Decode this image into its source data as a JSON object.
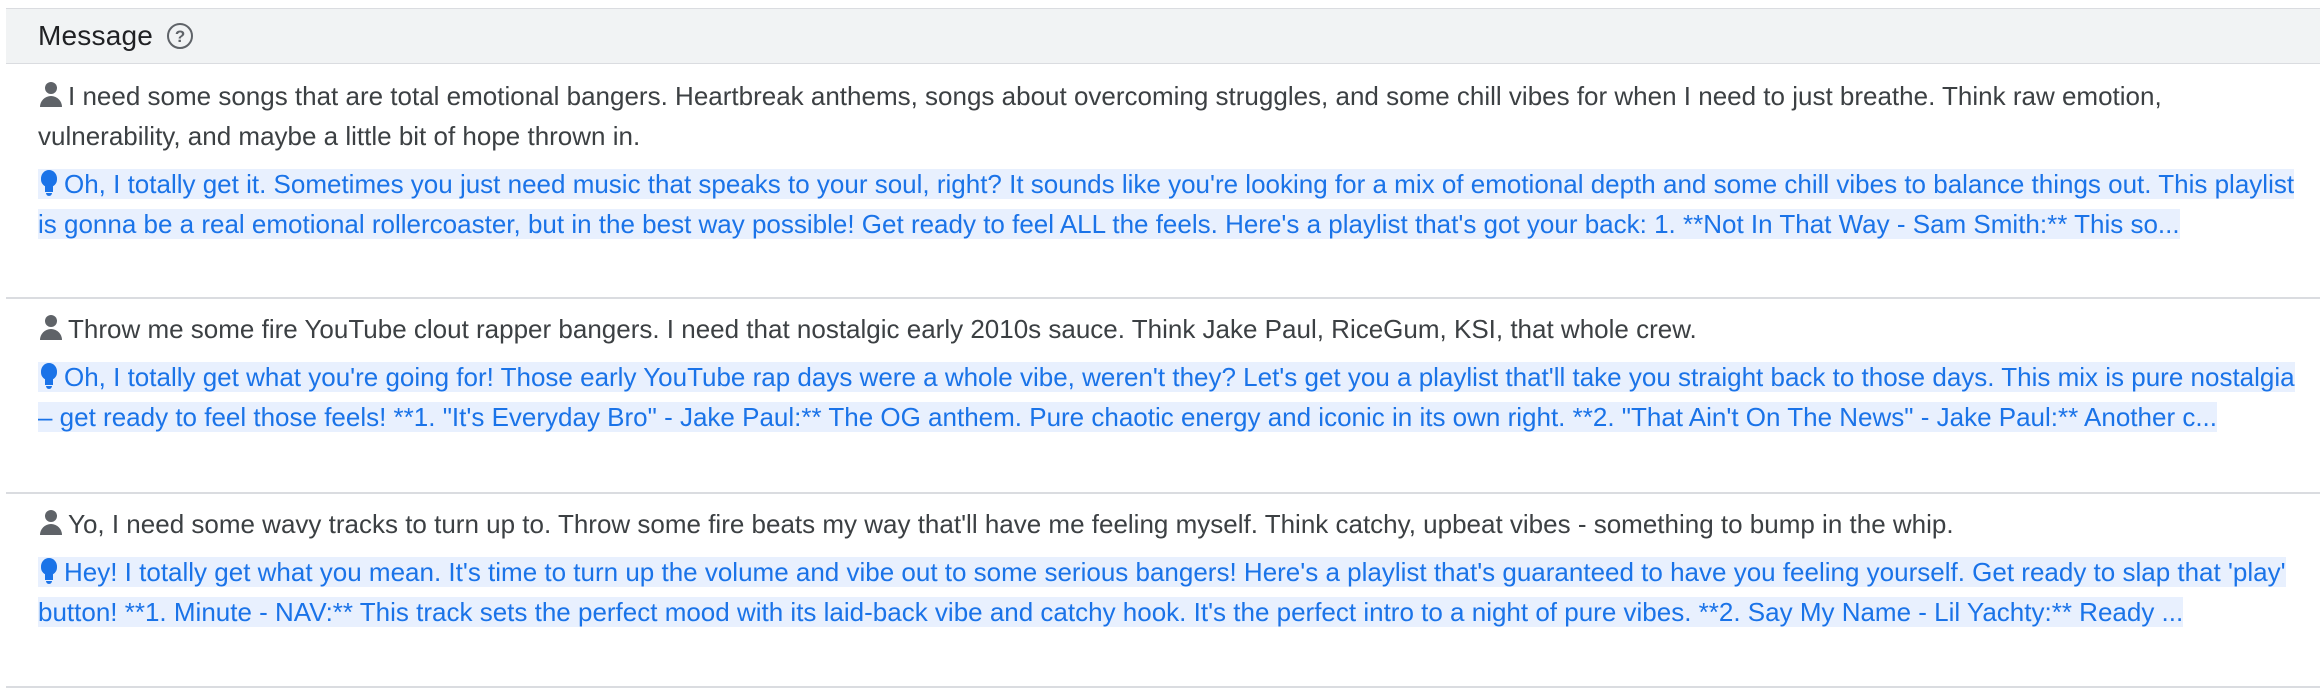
{
  "header": {
    "title": "Message",
    "help_icon": "help-circle-icon"
  },
  "messages": [
    {
      "user": "I need some songs that are total emotional bangers. Heartbreak anthems, songs about overcoming struggles, and some chill vibes for when I need to just breathe. Think raw emotion, vulnerability, and maybe a little bit of hope thrown in.",
      "bot": "Oh, I totally get it. Sometimes you just need music that speaks to your soul, right? It sounds like you're looking for a mix of emotional depth and some chill vibes to balance things out. This playlist is gonna be a real emotional rollercoaster, but in the best way possible! Get ready to feel ALL the feels. Here's a playlist that's got your back: 1. **Not In That Way - Sam Smith:** This so..."
    },
    {
      "user": "Throw me some fire YouTube clout rapper bangers. I need that nostalgic early 2010s sauce. Think Jake Paul, RiceGum, KSI, that whole crew.",
      "bot": "Oh, I totally get what you're going for! Those early YouTube rap days were a whole vibe, weren't they? Let's get you a playlist that'll take you straight back to those days. This mix is pure nostalgia – get ready to feel those feels! **1. \"It's Everyday Bro\" - Jake Paul:** The OG anthem. Pure chaotic energy and iconic in its own right. **2. \"That Ain't On The News\" - Jake Paul:** Another c..."
    },
    {
      "user": "Yo, I need some wavy tracks to turn up to. Throw some fire beats my way that'll have me feeling myself. Think catchy, upbeat vibes - something to bump in the whip.",
      "bot": "Hey! I totally get what you mean. It's time to turn up the volume and vibe out to some serious bangers! Here's a playlist that's guaranteed to have you feeling yourself. Get ready to slap that 'play' button! **1. Minute - NAV:** This track sets the perfect mood with its laid-back vibe and catchy hook. It's the perfect intro to a night of pure vibes. **2. Say My Name - Lil Yachty:** Ready ..."
    }
  ],
  "icons": {
    "user": "person-icon",
    "bot": "lightbulb-icon"
  },
  "colors": {
    "highlight_bg": "#e8f0fe",
    "highlight_text": "#1a73e8",
    "header_bg": "#f1f3f4",
    "body_text": "#3c4043"
  }
}
